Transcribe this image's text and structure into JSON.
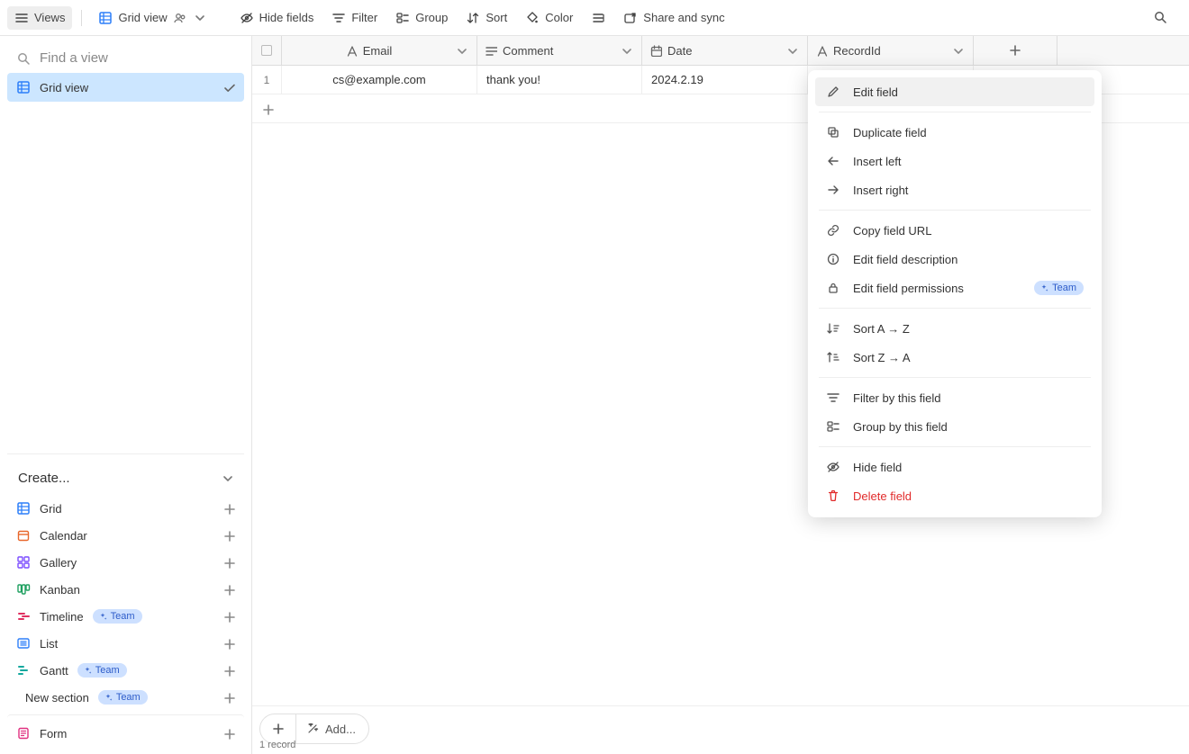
{
  "toolbar": {
    "views_label": "Views",
    "grid_view_label": "Grid view",
    "hide_fields_label": "Hide fields",
    "filter_label": "Filter",
    "group_label": "Group",
    "sort_label": "Sort",
    "color_label": "Color",
    "share_label": "Share and sync"
  },
  "sidebar": {
    "find_placeholder": "Find a view",
    "views": [
      {
        "label": "Grid view",
        "selected": true
      }
    ],
    "create_header": "Create...",
    "create_items": [
      {
        "label": "Grid",
        "icon": "grid",
        "color": "#2d7ff9",
        "team": false
      },
      {
        "label": "Calendar",
        "icon": "calendar",
        "color": "#e8672b",
        "team": false
      },
      {
        "label": "Gallery",
        "icon": "gallery",
        "color": "#7c4dff",
        "team": false
      },
      {
        "label": "Kanban",
        "icon": "kanban",
        "color": "#20a060",
        "team": false
      },
      {
        "label": "Timeline",
        "icon": "timeline",
        "color": "#e03060",
        "team": true
      },
      {
        "label": "List",
        "icon": "list",
        "color": "#2d7ff9",
        "team": false
      },
      {
        "label": "Gantt",
        "icon": "gantt",
        "color": "#13a89e",
        "team": true
      },
      {
        "label": "New section",
        "icon": "",
        "color": "#333333",
        "team": true
      },
      {
        "label": "Form",
        "icon": "form",
        "color": "#e03080",
        "team": false
      }
    ],
    "team_label": "Team"
  },
  "grid": {
    "columns": [
      {
        "label": "Email",
        "type": "text"
      },
      {
        "label": "Comment",
        "type": "long"
      },
      {
        "label": "Date",
        "type": "date"
      },
      {
        "label": "RecordId",
        "type": "text"
      }
    ],
    "rows": [
      {
        "email": "cs@example.com",
        "comment": "thank you!",
        "date": "2024.2.19",
        "recordid": ""
      }
    ],
    "footer_add_label": "Add...",
    "record_count_label": "1 record"
  },
  "context_menu": {
    "items_group1": [
      {
        "label": "Edit field",
        "icon": "pencil",
        "hovered": true
      }
    ],
    "items_group2": [
      {
        "label": "Duplicate field",
        "icon": "duplicate"
      },
      {
        "label": "Insert left",
        "icon": "arrow-left"
      },
      {
        "label": "Insert right",
        "icon": "arrow-right"
      }
    ],
    "items_group3": [
      {
        "label": "Copy field URL",
        "icon": "link"
      },
      {
        "label": "Edit field description",
        "icon": "info"
      },
      {
        "label": "Edit field permissions",
        "icon": "lock",
        "team": true
      }
    ],
    "items_group4": [
      {
        "label": "Sort A → Z",
        "icon": "sort-az"
      },
      {
        "label": "Sort Z → A",
        "icon": "sort-za"
      }
    ],
    "items_group5": [
      {
        "label": "Filter by this field",
        "icon": "filter"
      },
      {
        "label": "Group by this field",
        "icon": "group"
      }
    ],
    "items_group6": [
      {
        "label": "Hide field",
        "icon": "hide"
      },
      {
        "label": "Delete field",
        "icon": "trash",
        "danger": true
      }
    ],
    "team_label": "Team"
  }
}
